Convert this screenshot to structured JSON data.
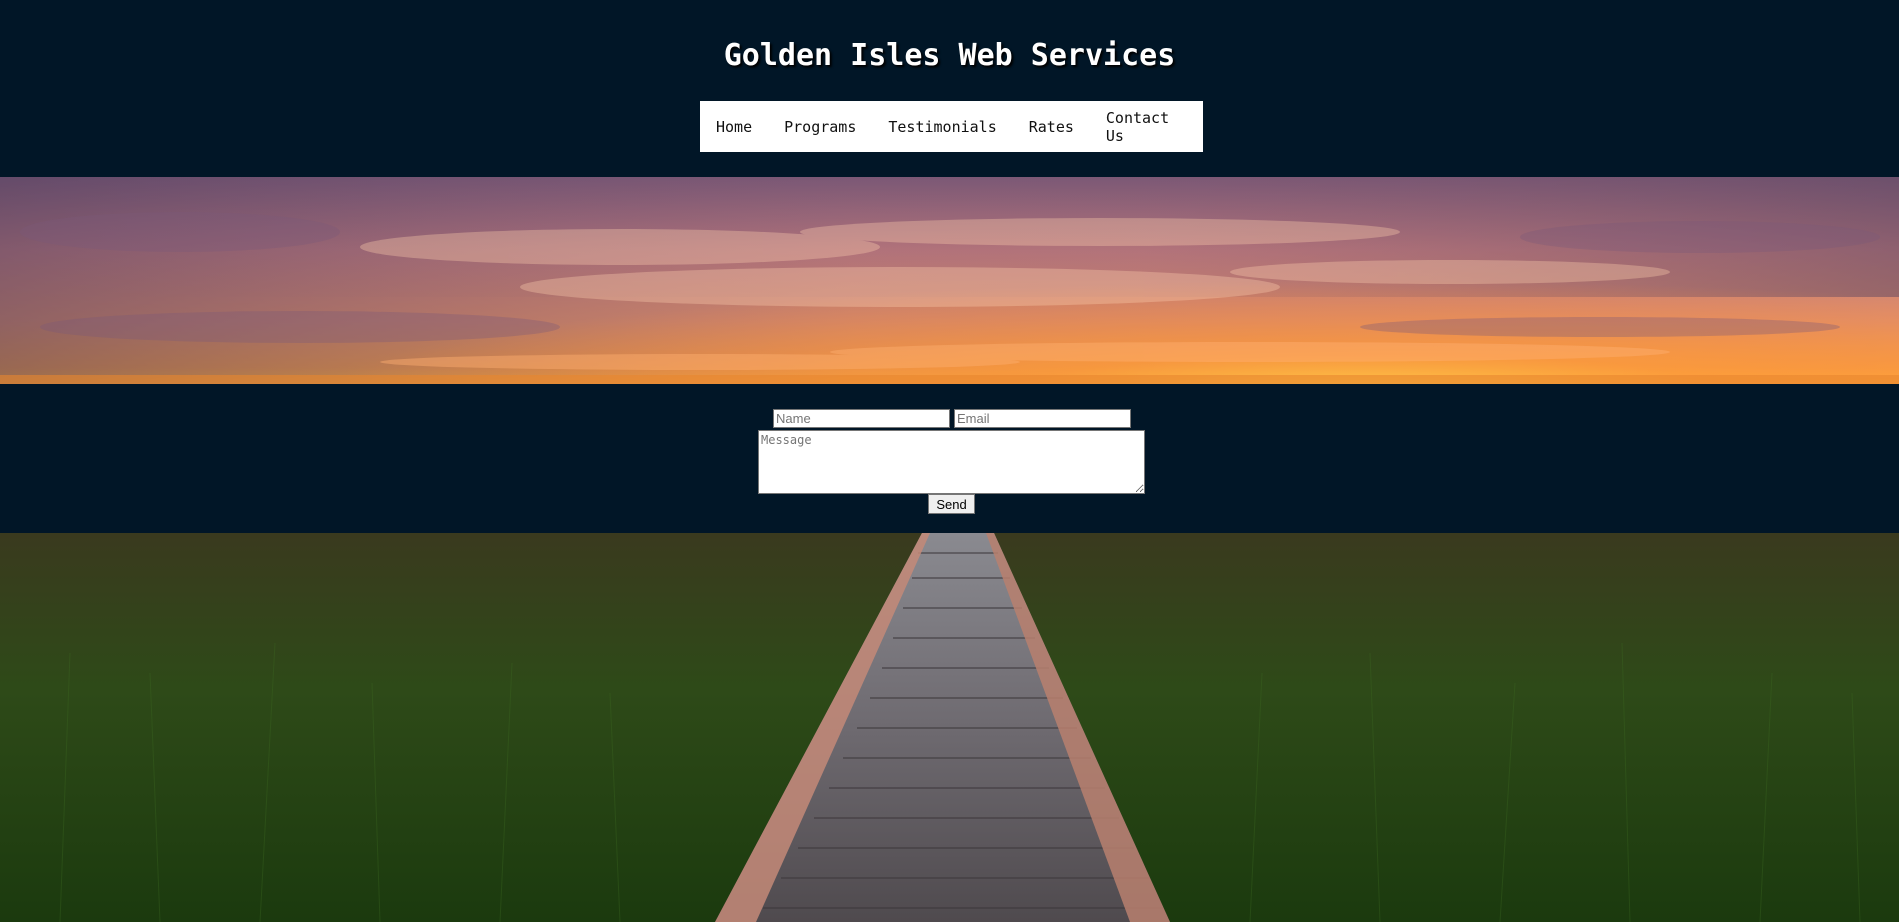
{
  "header": {
    "title": "Golden Isles Web Services"
  },
  "nav": {
    "items": [
      {
        "label": "Home"
      },
      {
        "label": "Programs"
      },
      {
        "label": "Testimonials"
      },
      {
        "label": "Rates"
      },
      {
        "label": "Contact Us"
      }
    ]
  },
  "form": {
    "name_placeholder": "Name",
    "email_placeholder": "Email",
    "message_placeholder": "Message",
    "send_label": "Send"
  },
  "colors": {
    "background": "#011627",
    "nav_background": "#ffffff",
    "title_color": "#ffffff"
  }
}
